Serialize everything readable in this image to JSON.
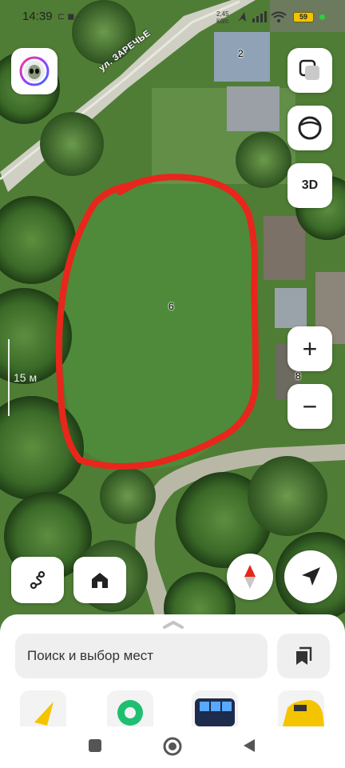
{
  "status_bar": {
    "time": "14:39",
    "extra_icons": "⊏ ◼ ·",
    "net_speed_value": "2,45",
    "net_speed_unit": "Кб/с",
    "battery": "59"
  },
  "map": {
    "street_name": "ул. ЗАРЕЧЬЕ",
    "house_numbers": [
      "2",
      "6",
      "8"
    ],
    "scale_label": "15 м",
    "outline_color": "#e8261c"
  },
  "controls": {
    "layers_icon": "layers-icon",
    "sphere_icon": "panorama-icon",
    "three_d_label": "3D",
    "zoom_in": "+",
    "zoom_out": "−",
    "compass_icon": "compass-icon",
    "locate_icon": "location-arrow-icon",
    "route_icon": "route-icon",
    "home_icon": "home-icon",
    "profile_icon": "alien-avatar-icon"
  },
  "sheet": {
    "search_placeholder": "Поиск и выбор мест",
    "bookmarks_icon": "bookmarks-icon"
  },
  "colors": {
    "accent_red": "#e8261c",
    "battery": "#f2c400",
    "online_dot": "#2fce3b"
  }
}
